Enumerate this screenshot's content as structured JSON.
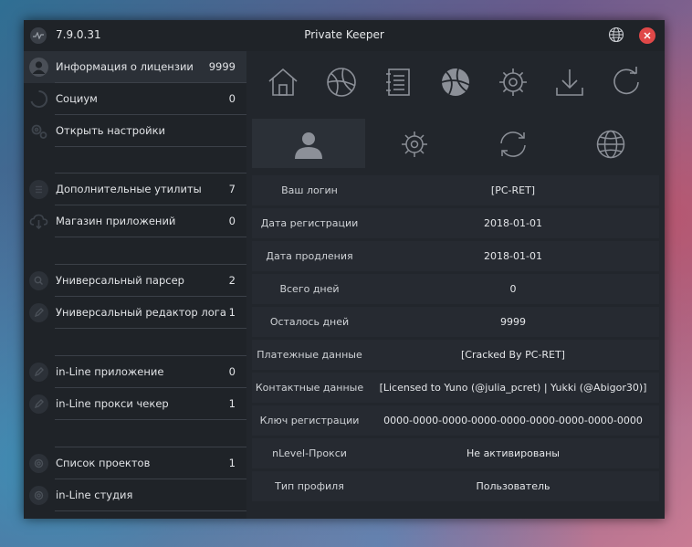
{
  "titlebar": {
    "version": "7.9.0.31",
    "title": "Private Keeper"
  },
  "sidebar": {
    "items": [
      {
        "label": "Информация о лицензии",
        "count": "9999",
        "icon": "user-icon"
      },
      {
        "label": "Социум",
        "count": "0",
        "icon": "loading-icon"
      },
      {
        "label": "Открыть настройки",
        "count": "",
        "icon": "gears-icon"
      },
      {
        "label": "Дополнительные утилиты",
        "count": "7",
        "icon": "list-icon"
      },
      {
        "label": "Магазин приложений",
        "count": "0",
        "icon": "cloud-download-icon"
      },
      {
        "label": "Универсальный парсер",
        "count": "2",
        "icon": "search-icon"
      },
      {
        "label": "Универсальный редактор лога",
        "count": "1",
        "icon": "pencil-icon"
      },
      {
        "label": "in-Line приложение",
        "count": "0",
        "icon": "pencil-icon"
      },
      {
        "label": "in-Line прокси чекер",
        "count": "1",
        "icon": "pencil-icon"
      },
      {
        "label": "Список проектов",
        "count": "1",
        "icon": "gear-icon"
      },
      {
        "label": "in-Line студия",
        "count": "",
        "icon": "gear-icon"
      }
    ]
  },
  "toolbar": {
    "icons": [
      "home-icon",
      "basketball-icon",
      "notebook-icon",
      "ball-icon",
      "gear-icon",
      "download-icon",
      "refresh-icon"
    ]
  },
  "subtabs": [
    "user-icon",
    "gear-icon",
    "sync-icon",
    "globe-icon"
  ],
  "info": {
    "rows": [
      {
        "label": "Ваш логин",
        "value": "[PC-RET]"
      },
      {
        "label": "Дата регистрации",
        "value": "2018-01-01"
      },
      {
        "label": "Дата продления",
        "value": "2018-01-01"
      },
      {
        "label": "Всего дней",
        "value": "0"
      },
      {
        "label": "Осталось дней",
        "value": "9999"
      },
      {
        "label": "Платежные данные",
        "value": "[Cracked By PC-RET]"
      },
      {
        "label": "Контактные данные",
        "value": "[Licensed to Yuno (@julia_pcret) | Yukki (@Abigor30)]"
      },
      {
        "label": "Ключ регистрации",
        "value": "0000-0000-0000-0000-0000-0000-0000-0000-0000"
      },
      {
        "label": "nLevel-Прокси",
        "value": "Не активированы"
      },
      {
        "label": "Тип профиля",
        "value": "Пользователь"
      }
    ]
  },
  "colors": {
    "window_bg": "#22262c",
    "sidebar_bg": "#1f2328",
    "row_bg": "#262a31",
    "close_red": "#e04848",
    "icon_gray": "#8c9098"
  }
}
